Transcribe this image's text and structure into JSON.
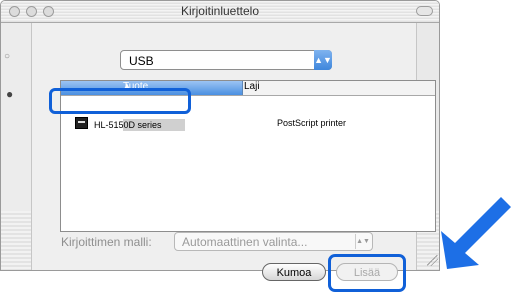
{
  "window": {
    "title": "Kirjoitinluettelo"
  },
  "connection_select": {
    "value": "USB",
    "icon": "up-down-arrows-icon"
  },
  "printer_list": {
    "columns": [
      "Tuote",
      "Laji"
    ],
    "sort_column": "Tuote",
    "rows": [
      {
        "name": "HL-5150D series",
        "type": "PostScript printer",
        "selected": true
      }
    ]
  },
  "model_field": {
    "label": "Kirjoittimen malli:",
    "value": "Automaattinen valinta...",
    "disabled": true
  },
  "buttons": {
    "cancel_label": "Kumoa",
    "add_label": "Lisää",
    "add_disabled": true
  },
  "annotation": {
    "color": "#1060d8",
    "callouts": [
      "printer-row",
      "add-button"
    ]
  }
}
